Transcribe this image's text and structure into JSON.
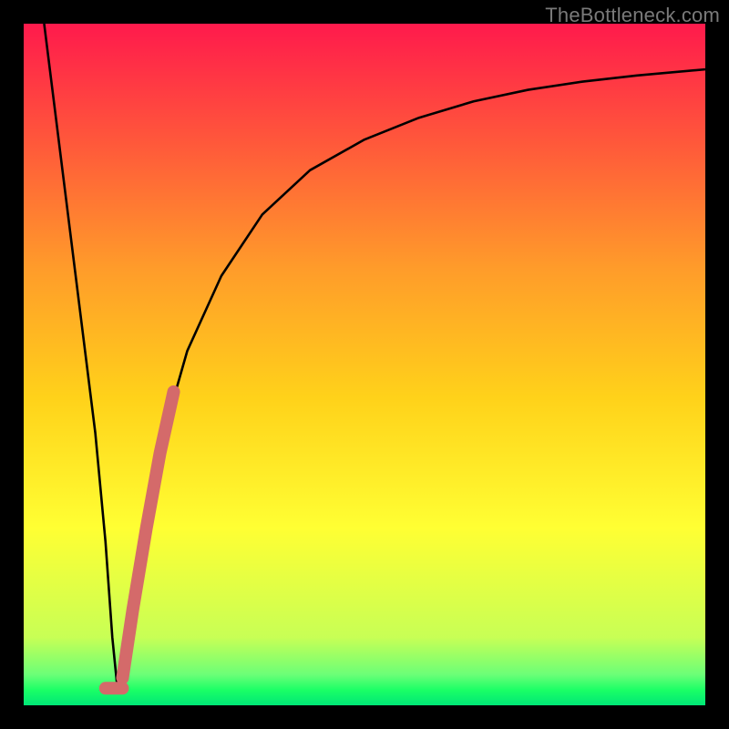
{
  "watermark": "TheBottleneck.com",
  "chart_data": {
    "type": "line",
    "title": "",
    "xlabel": "",
    "ylabel": "",
    "xlim": [
      0,
      100
    ],
    "ylim": [
      0,
      100
    ],
    "grid": false,
    "legend": false,
    "annotations": [],
    "background_gradient_colors_top_to_bottom": [
      "#ff1a4c",
      "#ff5a3a",
      "#ff9c2a",
      "#ffd21a",
      "#ffff33",
      "#c8ff55",
      "#6bff77",
      "#1aff66",
      "#00e676"
    ],
    "series": [
      {
        "name": "curve-left-descent",
        "stroke": "#000000",
        "stroke_width": 2.6,
        "x": [
          3,
          4.5,
          6,
          7.5,
          9,
          10.5,
          12,
          13,
          13.8
        ],
        "y": [
          100,
          88,
          76,
          64,
          52,
          40,
          24,
          10,
          2
        ]
      },
      {
        "name": "curve-right-ascend",
        "stroke": "#000000",
        "stroke_width": 2.6,
        "x": [
          13.8,
          15,
          17,
          20,
          24,
          29,
          35,
          42,
          50,
          58,
          66,
          74,
          82,
          90,
          100
        ],
        "y": [
          2,
          9,
          22,
          38,
          52,
          63,
          72,
          78.5,
          83,
          86.2,
          88.6,
          90.3,
          91.5,
          92.4,
          93.3
        ]
      },
      {
        "name": "highlight-segment",
        "stroke": "#d46a6a",
        "stroke_width": 14,
        "linecap": "round",
        "x": [
          14.5,
          16,
          18,
          20,
          22
        ],
        "y": [
          4,
          14,
          26,
          37,
          46
        ]
      },
      {
        "name": "highlight-tip",
        "stroke": "#d46a6a",
        "stroke_width": 14,
        "linecap": "round",
        "x": [
          12.0,
          14.5
        ],
        "y": [
          2.5,
          2.5
        ]
      }
    ]
  }
}
